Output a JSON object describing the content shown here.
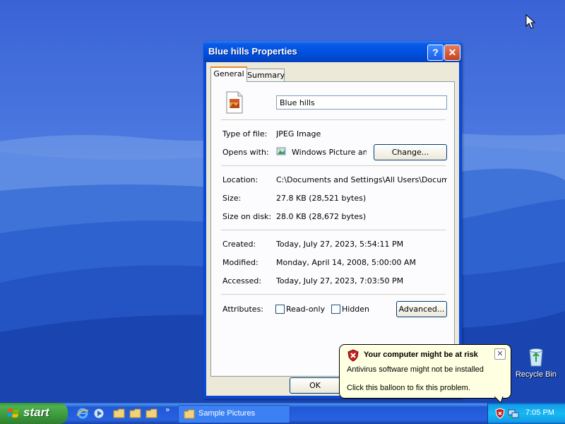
{
  "window": {
    "title": "Blue hills Properties",
    "help_glyph": "?",
    "close_glyph": "✕"
  },
  "tabs": [
    {
      "label": "General",
      "active": true
    },
    {
      "label": "Summary",
      "active": false
    }
  ],
  "general": {
    "file_name": "Blue hills",
    "type_label": "Type of file:",
    "type_value": "JPEG Image",
    "opens_label": "Opens with:",
    "opens_value": "Windows Picture and F",
    "change_button": "Change...",
    "location_label": "Location:",
    "location_value": "C:\\Documents and Settings\\All Users\\Documents\\M",
    "size_label": "Size:",
    "size_value": "27.8 KB (28,521 bytes)",
    "size_disk_label": "Size on disk:",
    "size_disk_value": "28.0 KB (28,672 bytes)",
    "created_label": "Created:",
    "created_value": "Today, July 27, 2023, 5:54:11 PM",
    "modified_label": "Modified:",
    "modified_value": "Monday, April 14, 2008, 5:00:00 AM",
    "accessed_label": "Accessed:",
    "accessed_value": "Today, July 27, 2023, 7:03:50 PM",
    "attributes_label": "Attributes:",
    "readonly_label": "Read-only",
    "readonly_checked": false,
    "hidden_label": "Hidden",
    "hidden_checked": false,
    "advanced_button": "Advanced..."
  },
  "footer": {
    "ok_button": "OK"
  },
  "balloon": {
    "title": "Your computer might be at risk",
    "line1": "Antivirus software might not be installed",
    "line2": "Click this balloon to fix this problem.",
    "close_glyph": "✕"
  },
  "desktop": {
    "recycle_bin_label": "Recycle Bin"
  },
  "taskbar": {
    "start_label": "start",
    "chevron": "»",
    "task_button_label": "Sample Pictures",
    "clock": "7:05 PM"
  },
  "colors": {
    "title_bar": "#0052e0",
    "start_button": "#3c9a3c",
    "taskbar": "#2663e0",
    "tray": "#18b9f2",
    "balloon": "#ffffe1",
    "dialog_face": "#ece9d8"
  }
}
